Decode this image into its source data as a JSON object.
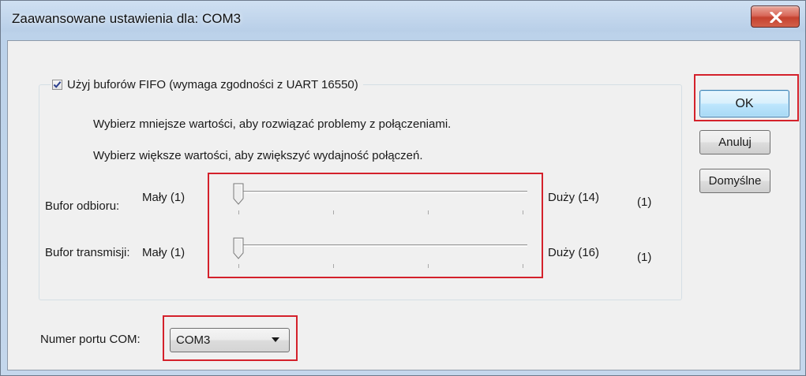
{
  "window": {
    "title": "Zaawansowane ustawienia dla: COM3"
  },
  "fifo": {
    "checkbox_label": "Użyj buforów FIFO (wymaga zgodności z UART 16550)",
    "checked": true,
    "hint_smaller": "Wybierz mniejsze wartości, aby rozwiązać problemy z połączeniami.",
    "hint_larger": "Wybierz większe wartości, aby zwiększyć wydajność połączeń."
  },
  "receive_buffer": {
    "label": "Bufor odbioru:",
    "min_label": "Mały (1)",
    "max_label": "Duży (14)",
    "current_display": "(1)",
    "value": 1,
    "min": 1,
    "max": 14
  },
  "transmit_buffer": {
    "label": "Bufor transmisji:",
    "min_label": "Mały (1)",
    "max_label": "Duży (16)",
    "current_display": "(1)",
    "value": 1,
    "min": 1,
    "max": 16
  },
  "port": {
    "label": "Numer portu COM:",
    "selected": "COM3"
  },
  "buttons": {
    "ok": "OK",
    "cancel": "Anuluj",
    "defaults": "Domyślne"
  },
  "icons": {
    "close": "close-icon",
    "check": "checkmark-icon",
    "dropdown": "chevron-down-icon",
    "slider_thumb": "slider-thumb-icon"
  },
  "colors": {
    "highlight": "#d4212b",
    "ok_button": "#bee6fd",
    "close_button": "#c5422f"
  }
}
